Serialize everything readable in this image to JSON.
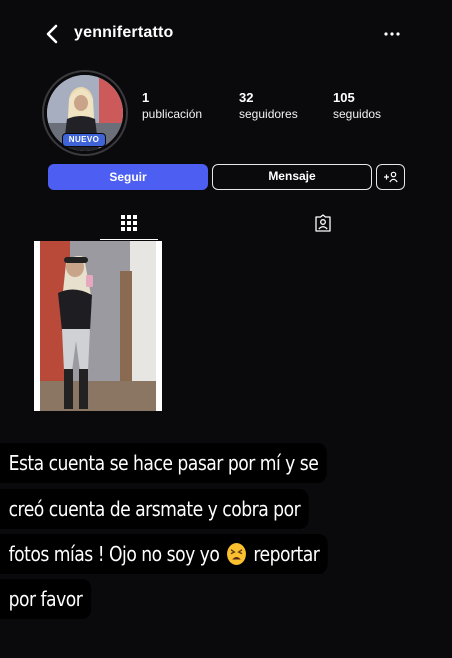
{
  "header": {
    "username": "yennifertatto",
    "back_icon": "chevron-left-icon",
    "more_icon": "more-horizontal-icon"
  },
  "profile": {
    "badge": "NUEVO",
    "stats": {
      "posts": {
        "value": "1",
        "label": "publicación"
      },
      "followers": {
        "value": "32",
        "label": "seguidores"
      },
      "following": {
        "value": "105",
        "label": "seguidos"
      }
    }
  },
  "actions": {
    "follow_label": "Seguir",
    "message_label": "Mensaje",
    "suggest_icon": "add-person-icon"
  },
  "tabs": {
    "grid_icon": "grid-icon",
    "tagged_icon": "tagged-person-icon"
  },
  "caption": {
    "line1": "Esta cuenta se hace pasar por mí y se",
    "line2": "creó cuenta de arsmate y cobra por",
    "line3_before": "fotos mías ! Ojo no soy yo",
    "line3_after": "reportar",
    "line4": "por favor",
    "emoji": "tired-face-emoji"
  },
  "colors": {
    "background": "#0a0a0c",
    "follow_button": "#4d5ef2",
    "badge": "#3f64d8",
    "caption_bg": "#000000"
  }
}
